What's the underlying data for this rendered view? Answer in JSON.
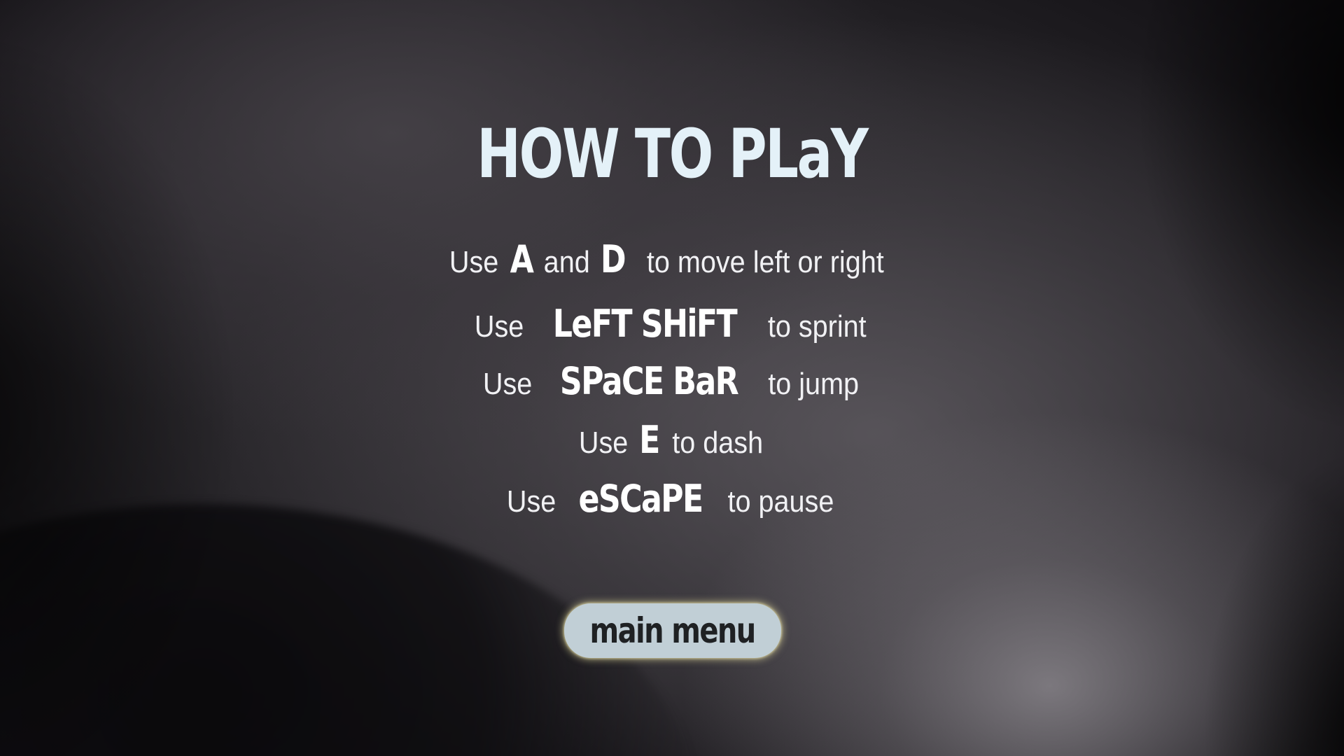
{
  "screen": {
    "title": "HOW TO PLaY"
  },
  "instructions": [
    {
      "prefix": "Use",
      "key": "A",
      "middle": "and",
      "key2": "D",
      "suffix": "to move left or right"
    },
    {
      "prefix": "Use",
      "key": "LeFT SHiFT",
      "suffix": "to sprint"
    },
    {
      "prefix": "Use",
      "key": "SPaCE BaR",
      "suffix": "to jump"
    },
    {
      "prefix": "Use",
      "key": "E",
      "suffix": "to dash"
    },
    {
      "prefix": "Use",
      "key": "eSCaPE",
      "suffix": "to pause"
    }
  ],
  "menu_button": {
    "label": "main menu"
  },
  "colors": {
    "title": "#e4f1f8",
    "button_bg": "#c1cfd6",
    "button_text": "#1f2123",
    "button_glow": "#e6dea0"
  }
}
